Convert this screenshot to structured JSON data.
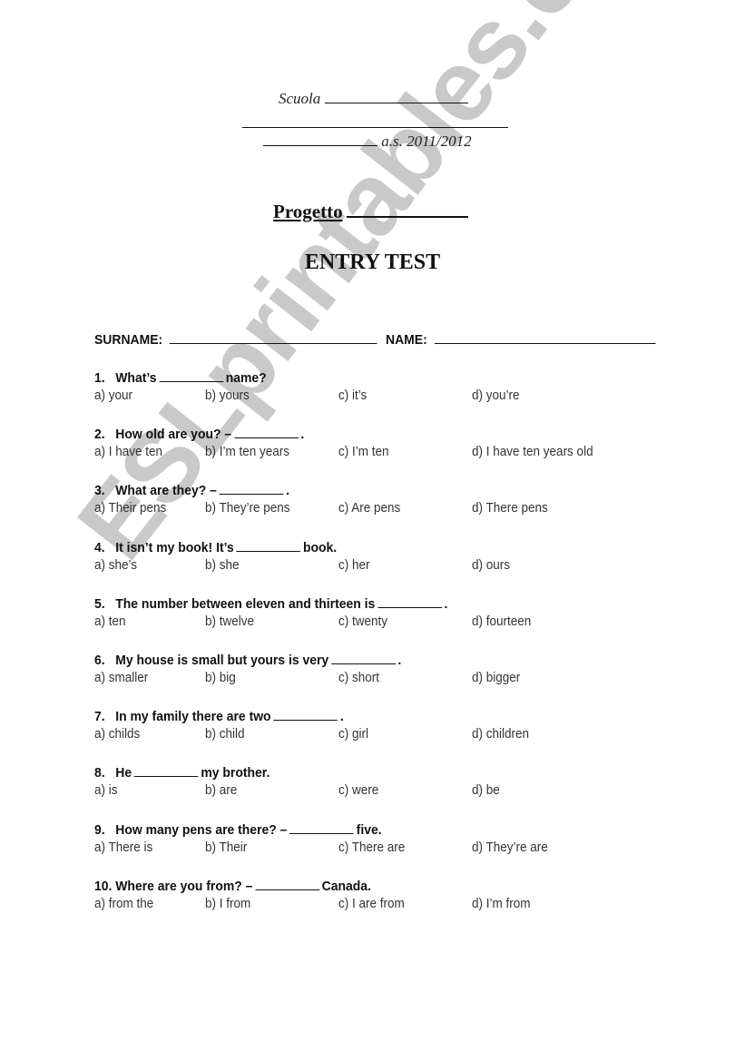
{
  "watermark": "ESLprintables.com",
  "header": {
    "school_label": "Scuola",
    "year_label": "a.s. 2011/2012",
    "project_label": "Progetto",
    "title": "ENTRY TEST"
  },
  "student": {
    "surname_label": "SURNAME:",
    "name_label": "NAME:"
  },
  "questions": [
    {
      "number": "1.",
      "before": "What’s",
      "after": "name?",
      "options": [
        "a) your",
        "b) yours",
        "c) it’s",
        "d) you’re"
      ]
    },
    {
      "number": "2.",
      "before": "How old are you? –",
      "after": ".",
      "options": [
        "a) I have ten",
        "b) I’m ten years",
        "c) I’m ten",
        "d) I have ten years old"
      ]
    },
    {
      "number": "3.",
      "before": "What are they? –",
      "after": ".",
      "options": [
        "a) Their pens",
        "b) They’re pens",
        "c) Are pens",
        "d) There pens"
      ]
    },
    {
      "number": "4.",
      "before": "It isn’t my book! It’s",
      "after": "book.",
      "options": [
        "a) she’s",
        "b) she",
        "c) her",
        "d) ours"
      ]
    },
    {
      "number": "5.",
      "before": "The number between eleven and thirteen is",
      "after": ".",
      "options": [
        "a) ten",
        "b) twelve",
        "c) twenty",
        "d) fourteen"
      ]
    },
    {
      "number": "6.",
      "before": "My house is small but yours is very",
      "after": ".",
      "options": [
        "a) smaller",
        "b) big",
        "c) short",
        "d) bigger"
      ]
    },
    {
      "number": "7.",
      "before": "In my family there are two",
      "after": ".",
      "options": [
        "a) childs",
        "b) child",
        "c) girl",
        "d) children"
      ]
    },
    {
      "number": "8.",
      "before": "He",
      "after": "my brother.",
      "options": [
        "a) is",
        "b) are",
        "c) were",
        "d) be"
      ]
    },
    {
      "number": "9.",
      "before": "How many pens are there? –",
      "after": "five.",
      "options": [
        "a) There is",
        "b) Their",
        "c) There are",
        "d) They’re are"
      ]
    },
    {
      "number": "10.",
      "before": "Where are you from? –",
      "after": "Canada.",
      "options": [
        "a) from the",
        "b) I from",
        "c) I are from",
        "d) I’m from"
      ]
    }
  ]
}
